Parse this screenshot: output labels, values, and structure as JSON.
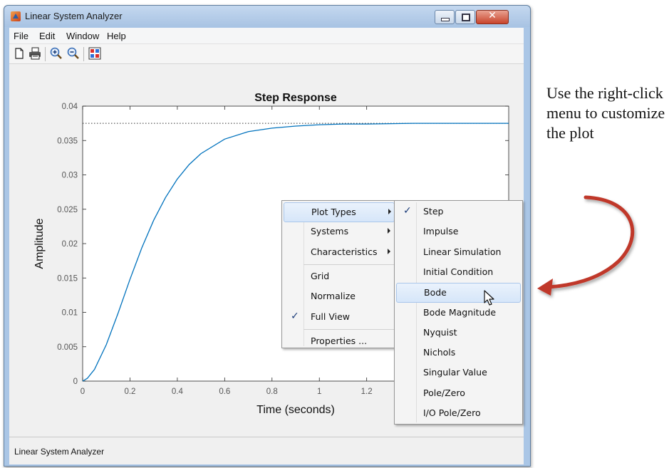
{
  "window": {
    "title": "Linear System Analyzer",
    "menu": [
      "File",
      "Edit",
      "Window",
      "Help"
    ],
    "toolbar_icons": [
      "new-figure-icon",
      "print-icon",
      "zoom-in-icon",
      "zoom-out-icon",
      "plot-configuration-icon"
    ],
    "status_text": "Linear System Analyzer"
  },
  "chart_data": {
    "type": "line",
    "title": "Step Response",
    "xlabel": "Time (seconds)",
    "ylabel": "Amplitude",
    "xlim": [
      0,
      1.8
    ],
    "ylim": [
      0,
      0.04
    ],
    "x_ticks": [
      "0",
      "0.2",
      "0.4",
      "0.6",
      "0.8",
      "1",
      "1.2"
    ],
    "y_ticks": [
      "0",
      "0.005",
      "0.01",
      "0.015",
      "0.02",
      "0.025",
      "0.03",
      "0.035",
      "0.04"
    ],
    "steady_state_value": 0.0375,
    "series": [
      {
        "color": "#0072bd",
        "x": [
          0,
          0.02,
          0.05,
          0.1,
          0.15,
          0.2,
          0.25,
          0.3,
          0.35,
          0.4,
          0.45,
          0.5,
          0.6,
          0.7,
          0.8,
          0.9,
          1.0,
          1.1,
          1.2,
          1.4,
          1.6,
          1.8
        ],
        "y": [
          0,
          0.0004,
          0.0017,
          0.0053,
          0.0099,
          0.0148,
          0.0194,
          0.0234,
          0.0267,
          0.0294,
          0.0315,
          0.0331,
          0.0352,
          0.0363,
          0.0368,
          0.0371,
          0.0373,
          0.0374,
          0.0374,
          0.0375,
          0.0375,
          0.0375
        ]
      }
    ]
  },
  "context_menu": {
    "items": [
      {
        "label": "Plot Types",
        "submenu": true,
        "checked": false,
        "highlighted": true
      },
      {
        "label": "Systems",
        "submenu": true,
        "checked": false,
        "highlighted": false
      },
      {
        "label": "Characteristics",
        "submenu": true,
        "checked": false,
        "highlighted": false
      },
      {
        "label": "Grid",
        "submenu": false,
        "checked": false,
        "highlighted": false
      },
      {
        "label": "Normalize",
        "submenu": false,
        "checked": false,
        "highlighted": false
      },
      {
        "label": "Full View",
        "submenu": false,
        "checked": true,
        "highlighted": false
      },
      {
        "label": "Properties ...",
        "submenu": false,
        "checked": false,
        "highlighted": false
      }
    ]
  },
  "plot_types_submenu": {
    "items": [
      {
        "label": "Step",
        "checked": true,
        "highlighted": false
      },
      {
        "label": "Impulse",
        "checked": false,
        "highlighted": false
      },
      {
        "label": "Linear Simulation",
        "checked": false,
        "highlighted": false
      },
      {
        "label": "Initial Condition",
        "checked": false,
        "highlighted": false
      },
      {
        "label": "Bode",
        "checked": false,
        "highlighted": true
      },
      {
        "label": "Bode Magnitude",
        "checked": false,
        "highlighted": false
      },
      {
        "label": "Nyquist",
        "checked": false,
        "highlighted": false
      },
      {
        "label": "Nichols",
        "checked": false,
        "highlighted": false
      },
      {
        "label": "Singular Value",
        "checked": false,
        "highlighted": false
      },
      {
        "label": "Pole/Zero",
        "checked": false,
        "highlighted": false
      },
      {
        "label": "I/O Pole/Zero",
        "checked": false,
        "highlighted": false
      }
    ]
  },
  "annotation": {
    "text": "Use the right-click menu to customize the plot",
    "arrow_color": "#c0392b"
  }
}
